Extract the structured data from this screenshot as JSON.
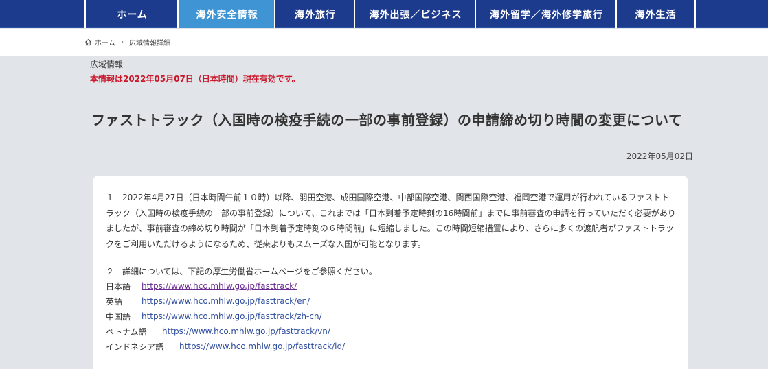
{
  "nav": {
    "items": [
      {
        "label": "ホーム"
      },
      {
        "label": "海外安全情報"
      },
      {
        "label": "海外旅行"
      },
      {
        "label": "海外出張／ビジネス"
      },
      {
        "label": "海外留学／海外修学旅行"
      },
      {
        "label": "海外生活"
      }
    ],
    "active_index": 1
  },
  "breadcrumb": {
    "home_label": "ホーム",
    "separator": "›",
    "current_label": "広域情報詳細"
  },
  "page": {
    "section_label": "広域情報",
    "validity_notice": "本情報は2022年05月07日（日本時間）現在有効です。",
    "title": "ファストトラック（入国時の検疫手続の一部の事前登録）の申請締め切り時間の変更について",
    "date": "2022年05月02日"
  },
  "body": {
    "paragraph1": "１　2022年4月27日（日本時間午前１０時）以降、羽田空港、成田国際空港、中部国際空港、関西国際空港、福岡空港で運用が行われているファストトラック（入国時の検疫手続の一部の事前登録）について、これまでは「日本到着予定時刻の16時間前」までに事前審査の申請を行っていただく必要がありましたが、事前審査の締め切り時間が「日本到着予定時刻の６時間前」に短縮しました。この時間短縮措置により、さらに多くの渡航者がファストトラックをご利用いただけるようになるため、従来よりもスムーズな入国が可能となります。",
    "paragraph2": "２　詳細については、下記の厚生労働省ホームページをご参照ください。",
    "links": [
      {
        "lang": "日本語",
        "url": "https://www.hco.mhlw.go.jp/fasttrack/"
      },
      {
        "lang": "英語",
        "url": "https://www.hco.mhlw.go.jp/fasttrack/en/"
      },
      {
        "lang": "中国語",
        "url": "https://www.hco.mhlw.go.jp/fasttrack/zh-cn/"
      },
      {
        "lang": "ベトナム語",
        "url": "https://www.hco.mhlw.go.jp/fasttrack/vn/"
      },
      {
        "lang": "インドネシア語",
        "url": "https://www.hco.mhlw.go.jp/fasttrack/id/"
      }
    ]
  },
  "colors": {
    "nav_bg": "#1d3b8c",
    "nav_active": "#3f95d3",
    "alert_red": "#c9182b",
    "link_blue": "#2f4e9e",
    "link_visited": "#6a2c91"
  }
}
